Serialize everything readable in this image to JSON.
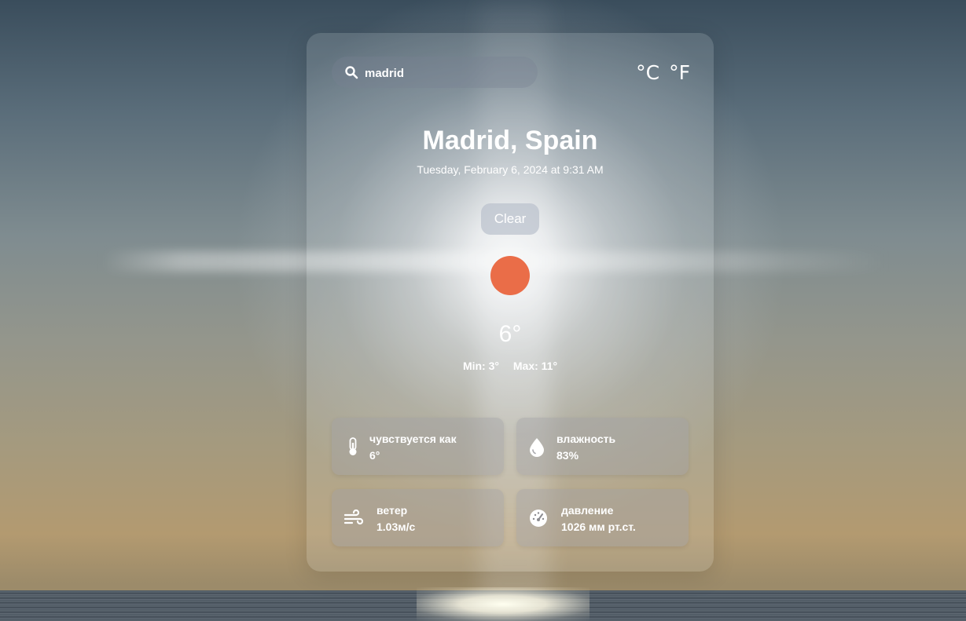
{
  "search": {
    "value": "madrid",
    "placeholder": "madrid"
  },
  "units": {
    "celsius": "°C",
    "fahrenheit": "°F"
  },
  "location": {
    "city": "Madrid, Spain",
    "datetime": "Tuesday, February 6, 2024 at 9:31 AM"
  },
  "weather": {
    "condition": "Clear",
    "icon": "sun-icon",
    "temperature": "6°",
    "min": "Min: 3°",
    "max": "Max: 11°"
  },
  "details": {
    "feels_like": {
      "label": "чувствуется как",
      "value": "6°",
      "icon": "thermometer-icon"
    },
    "humidity": {
      "label": "влажность",
      "value": "83%",
      "icon": "droplet-icon"
    },
    "wind": {
      "label": "ветер",
      "value": "1.03м/с",
      "icon": "wind-icon"
    },
    "pressure": {
      "label": "давление",
      "value": "1026 мм рт.ст.",
      "icon": "gauge-icon"
    }
  },
  "colors": {
    "sun": "#ea6d48",
    "text": "#ffffff"
  }
}
